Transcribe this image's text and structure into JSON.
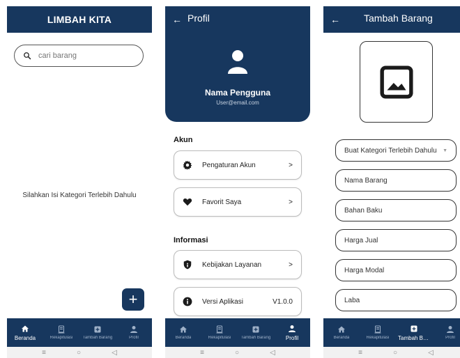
{
  "colors": {
    "primary": "#17375e",
    "nav_inactive": "#9fb1c8"
  },
  "screen1": {
    "header_title": "LIMBAH KITA",
    "search_placeholder": "cari barang",
    "empty_message": "Silahkan Isi Kategori Terlebih Dahulu",
    "fab_icon": "plus-icon",
    "fab_label": "+"
  },
  "screen2": {
    "title": "Profil",
    "user_name": "Nama Pengguna",
    "user_email": "User@email.com",
    "section_account": "Akun",
    "account_items": [
      {
        "label": "Pengaturan Akun",
        "icon": "gear-icon",
        "end": ">"
      },
      {
        "label": "Favorit Saya",
        "icon": "heart-icon",
        "end": ">"
      }
    ],
    "section_info": "Informasi",
    "info_items": [
      {
        "label": "Kebijakan Layanan",
        "icon": "shield-icon",
        "end": ">"
      },
      {
        "label": "Versi Aplikasi",
        "icon": "info-icon",
        "end": "V1.0.0"
      }
    ]
  },
  "screen3": {
    "title": "Tambah Barang",
    "image_placeholder_icon": "image-icon",
    "category_select": "Buat Kategori Terlebih Dahulu",
    "fields": [
      "Nama Barang",
      "Bahan Baku",
      "Harga Jual",
      "Harga Modal",
      "Laba"
    ]
  },
  "nav": {
    "items": [
      {
        "label": "Beranda",
        "icon": "home-icon"
      },
      {
        "label": "Rekapitulasi",
        "icon": "document-icon"
      },
      {
        "label": "Tambah Barang",
        "icon": "add-box-icon"
      },
      {
        "label": "Profil",
        "icon": "person-icon"
      }
    ],
    "active_by_screen": [
      "Beranda",
      "Profil",
      "Tambah Barang"
    ]
  },
  "system_bar": {
    "menu": "≡",
    "home": "○",
    "back": "◁"
  }
}
